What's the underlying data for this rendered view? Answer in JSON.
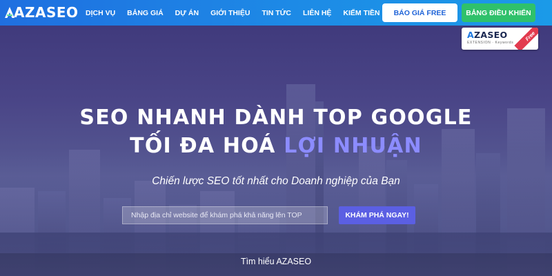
{
  "brand": {
    "logo_text": "AZASEO"
  },
  "nav": {
    "items": [
      "DỊCH VỤ",
      "BẢNG GIÁ",
      "DỰ ÁN",
      "GIỚI THIỆU",
      "TIN TỨC",
      "LIÊN HỆ",
      "KIẾM TIỀN"
    ]
  },
  "header_buttons": {
    "quote_label": "BÁO GIÁ FREE",
    "dashboard_label": "BẢNG ĐIỀU KHIỂN"
  },
  "extension_badge": {
    "logo_text": "ZASEO",
    "subtitle": "EXTENSION · Keywords",
    "ribbon": "Free"
  },
  "hero": {
    "headline_line1": "SEO NHANH DÀNH TOP GOOGLE",
    "headline_line2_plain": "TỐI ĐA HOÁ ",
    "headline_line2_accent": "LỢI NHUẬN",
    "tagline": "Chiến lược SEO tốt nhất cho Doanh nghiệp của Bạn",
    "search_placeholder": "Nhập địa chỉ website để khám phá khả năng lên TOP",
    "search_button": "KHÁM PHÁ NGAY!",
    "learn_more": "Tìm hiểu AZASEO"
  },
  "colors": {
    "header_start": "#1f6fe0",
    "header_end": "#1b9ae8",
    "dashboard_green": "#2fc16b",
    "accent_purple": "#8c8cff",
    "cta_button": "#5b5fe3",
    "ribbon_red": "#e23b4f"
  }
}
